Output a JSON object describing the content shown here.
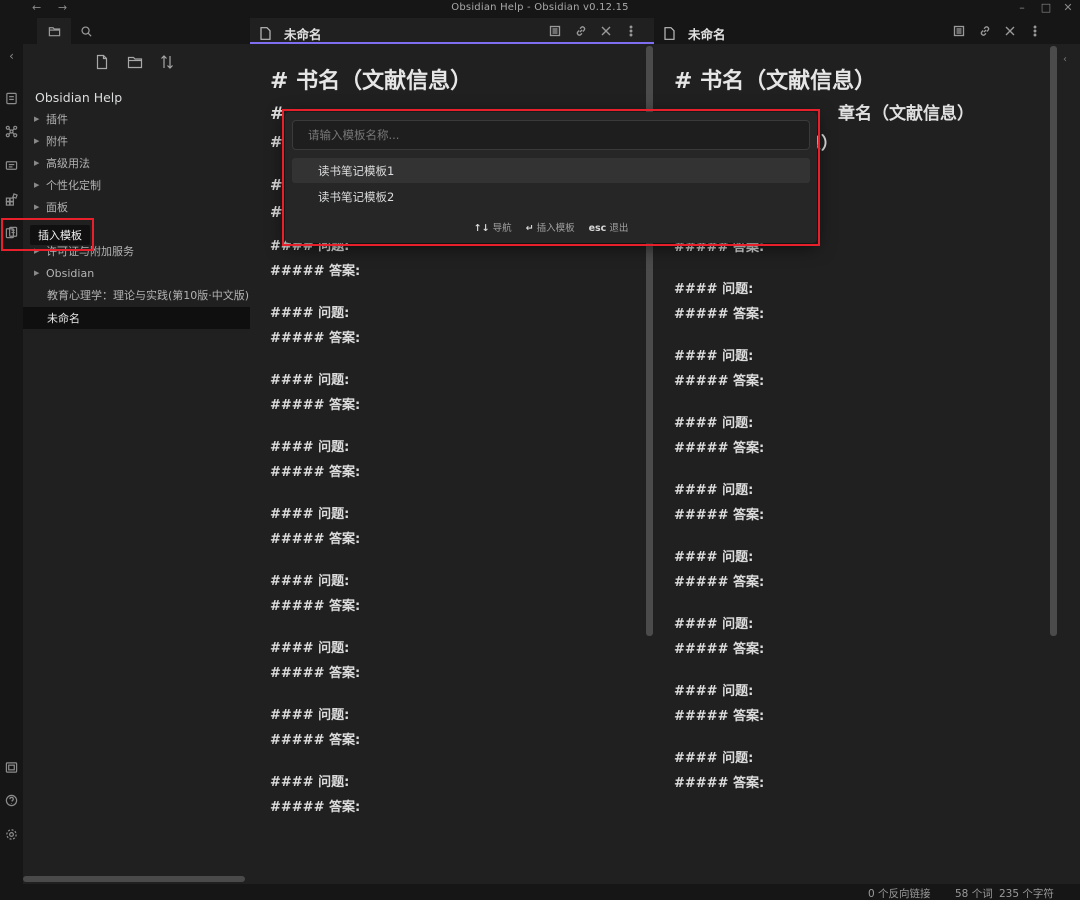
{
  "window": {
    "title": "Obsidian Help - Obsidian v0.12.15",
    "back": "←",
    "forward": "→",
    "minimize": "–",
    "maximize": "□",
    "close": "✕"
  },
  "ribbon": {
    "collapse": "‹",
    "icons": [
      "open-quick-switcher-icon",
      "graph-view-icon",
      "slides-icon",
      "plugins-icon",
      "insert-template-icon",
      "vault-icon",
      "help-icon",
      "settings-icon"
    ]
  },
  "sidebar": {
    "tabs": [
      "file-explorer-icon",
      "search-icon"
    ],
    "tools": [
      "new-note-icon",
      "new-folder-icon",
      "sort-icon"
    ],
    "vault_name": "Obsidian Help",
    "items": [
      {
        "label": "插件",
        "type": "folder"
      },
      {
        "label": "附件",
        "type": "folder"
      },
      {
        "label": "高级用法",
        "type": "folder"
      },
      {
        "label": "个性化定制",
        "type": "folder"
      },
      {
        "label": "面板",
        "type": "folder"
      },
      {
        "label": "",
        "type": "folder"
      },
      {
        "label": "许可证与附加服务",
        "type": "folder"
      },
      {
        "label": "Obsidian",
        "type": "folder"
      },
      {
        "label": "教育心理学：理论与实践(第10版·中文版)",
        "type": "file"
      },
      {
        "label": "未命名",
        "type": "file",
        "active": true
      }
    ],
    "tooltip": "插入模板"
  },
  "panes": [
    {
      "title": "未命名",
      "active": true,
      "h1": "# 书名（文献信息）",
      "h2": "## 章名（文献信息）",
      "h2_visible": "#",
      "h3": "###",
      "h3b": "#",
      "h4": "#",
      "question": "#### 问题:",
      "answer": "##### 答案:"
    },
    {
      "title": "未命名",
      "active": false,
      "h1": "# 书名（文献信息）",
      "h2_left": "##",
      "h2_fragment": "章名（文献信息）",
      "h3_fragment": "息）",
      "question": "#### 问题:",
      "answer": "##### 答案:"
    }
  ],
  "pane_actions": [
    "preview-icon",
    "link-icon",
    "close-icon",
    "more-options-icon"
  ],
  "modal": {
    "placeholder": "请输入模板名称...",
    "suggestions": [
      "读书笔记模板1",
      "读书笔记模板2"
    ],
    "footer": [
      {
        "key": "↑↓",
        "label": "导航"
      },
      {
        "key": "↵",
        "label": "插入模板"
      },
      {
        "key": "esc",
        "label": "退出"
      }
    ]
  },
  "status": {
    "backlinks": "0 个反向链接",
    "words": "58 个词",
    "chars": "235 个字符"
  }
}
